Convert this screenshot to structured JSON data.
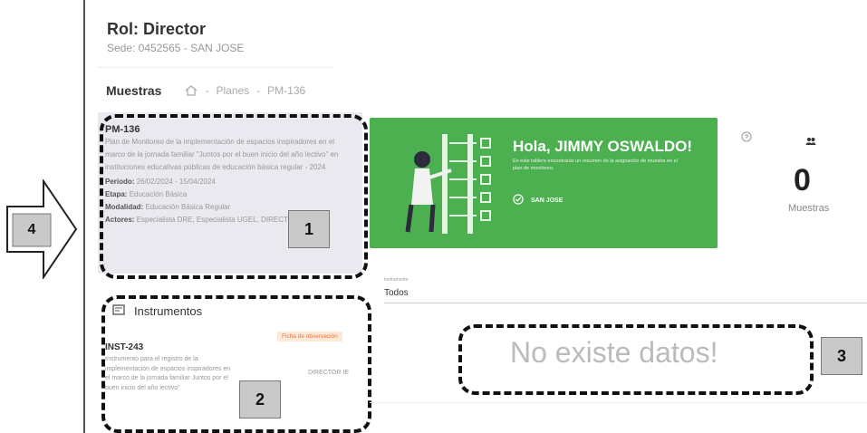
{
  "header": {
    "role_title": "Rol: Director",
    "sede": "Sede: 0452565 - SAN JOSE"
  },
  "breadcrumb": {
    "title": "Muestras",
    "home_icon": "home-icon",
    "sep1": "-",
    "planes": "Planes",
    "sep2": "-",
    "current": "PM-136"
  },
  "plan": {
    "code": "PM-136",
    "description": "Plan de Monitoreo de la implementación de espacios inspiradores en el marco de la jornada familiar \"Juntos por el buen inicio del año lectivo\" en instituciones educativas públicas de educación básica regular - 2024",
    "periodo_label": "Periodo:",
    "periodo_value": "26/02/2024 - 15/04/2024",
    "etapa_label": "Etapa:",
    "etapa_value": "Educación Básica",
    "modalidad_label": "Modalidad:",
    "modalidad_value": "Educación Básica Regular",
    "actores_label": "Actores:",
    "actores_value": "Especialista DRE, Especialista UGEL, DIRECTOR"
  },
  "instruments": {
    "title": "Instrumentos",
    "icon": "list-icon",
    "item": {
      "code": "INST-243",
      "description": "Instrumento para el registro de la implementación de espacios inspiradores en el marco de la jornada familiar Juntos por el buen inicio del año lectivo\"",
      "badge": "Ficha de observación",
      "role": "DIRECTOR IE"
    }
  },
  "banner": {
    "greeting": "Hola, JIMMY OSWALDO!",
    "subtitle": "En este tablero encontrarás un resumen de la asignación de muestra en el plan de monitoreo.",
    "sede": "SAN JOSE",
    "color": "#4caf50"
  },
  "stats": {
    "count": "0",
    "label": "Muestras",
    "people_icon": "people-icon",
    "help_icon": "help-circle-icon"
  },
  "filter": {
    "label": "Instrumento",
    "value": "Todos"
  },
  "empty_state": "No existe datos!",
  "annotations": {
    "n1": "1",
    "n2": "2",
    "n3": "3",
    "n4": "4"
  }
}
